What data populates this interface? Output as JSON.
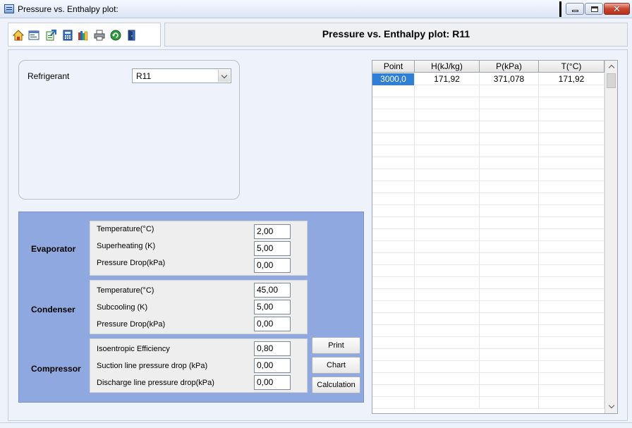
{
  "window": {
    "title": "Pressure vs. Enthalpy plot:"
  },
  "header": {
    "title": "Pressure vs. Enthalpy plot: R11"
  },
  "toolbar": {
    "icons": [
      "home-icon",
      "window-icon",
      "export-icon",
      "calculator-icon",
      "books-icon",
      "printer-icon",
      "refresh-icon",
      "exit-icon"
    ]
  },
  "refrigerant": {
    "label": "Refrigerant",
    "selected": "R11"
  },
  "evaporator": {
    "label": "Evaporator",
    "temperature_label": "Temperature(°C)",
    "temperature": "2,00",
    "superheating_label": "Superheating (K)",
    "superheating": "5,00",
    "pressure_drop_label": "Pressure Drop(kPa)",
    "pressure_drop": "0,00"
  },
  "condenser": {
    "label": "Condenser",
    "temperature_label": "Temperature(°C)",
    "temperature": "45,00",
    "subcooling_label": "Subcooling (K)",
    "subcooling": "5,00",
    "pressure_drop_label": "Pressure Drop(kPa)",
    "pressure_drop": "0,00"
  },
  "compressor": {
    "label": "Compressor",
    "efficiency_label": "Isoentropic Efficiency",
    "efficiency": "0,80",
    "suction_label": "Suction line pressure drop (kPa)",
    "suction": "0,00",
    "discharge_label": "Discharge line pressure drop(kPa)",
    "discharge": "0,00"
  },
  "buttons": {
    "print": "Print",
    "chart": "Chart",
    "calculation": "Calculation"
  },
  "grid": {
    "columns": [
      "Point",
      "H(kJ/kg)",
      "P(kPa)",
      "T(°C)"
    ],
    "rows": [
      [
        "3000,0",
        "171,92",
        "371,078",
        "171,92"
      ]
    ]
  },
  "colors": {
    "panel_blue": "#8fa8df",
    "selection": "#2f7fd6"
  }
}
